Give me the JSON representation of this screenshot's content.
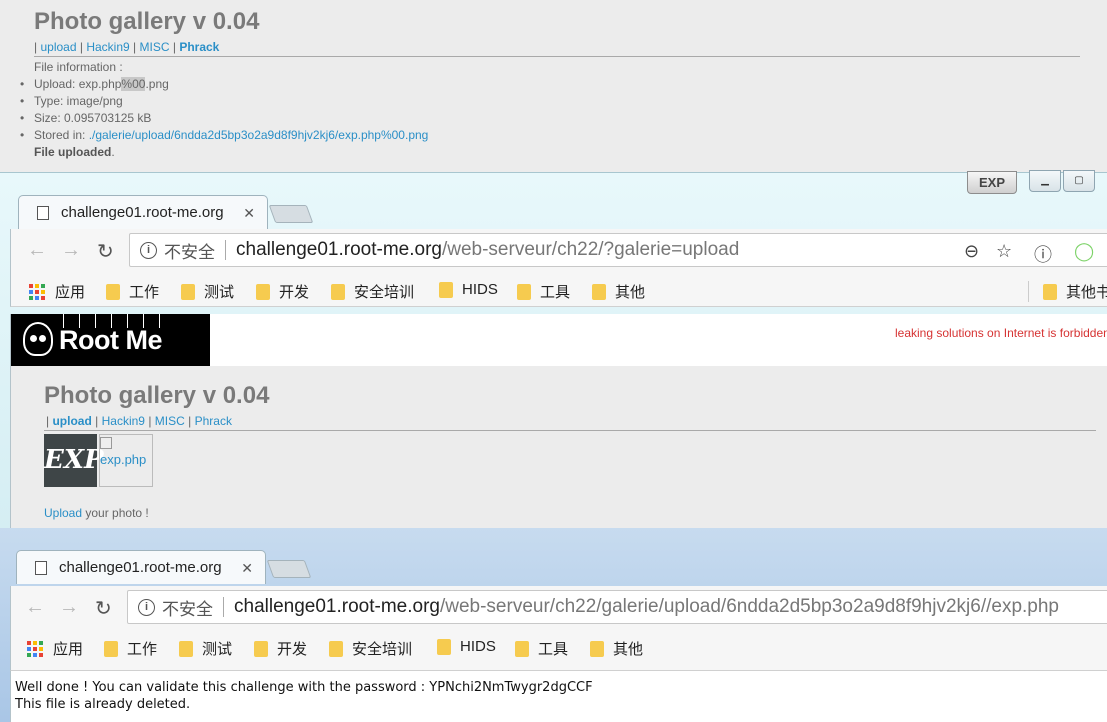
{
  "top_gallery": {
    "title": "Photo gallery v 0.04",
    "nav": {
      "sep": "|",
      "upload": "upload",
      "hackin9": "Hackin9",
      "misc": "MISC",
      "phrack": "Phrack"
    },
    "file_info_label": "File information :",
    "upload_label": "Upload:",
    "upload_name_pre": "exp.php",
    "upload_name_hl": "%00",
    "upload_name_post": ".png",
    "type": "Type: image/png",
    "size": "Size: 0.095703125 kB",
    "stored_label": "Stored in:",
    "stored_path": "./galerie/upload/6ndda2d5bp3o2a9d8f9hjv2kj6/exp.php%00.png",
    "file_uploaded_bold": "File uploaded",
    "file_uploaded_dot": "."
  },
  "window1": {
    "tab_title": "challenge01.root-me.org",
    "tab_close": "✕",
    "exp_button": "EXP",
    "address": {
      "insecure": "不安全",
      "host": "challenge01.root-me.org",
      "path": "/web-serveur/ch22/?galerie=upload"
    },
    "bookmarks": [
      "应用",
      "工作",
      "测试",
      "开发",
      "安全培训",
      "HIDS",
      "工具",
      "其他"
    ],
    "bookmarks_right": "其他书",
    "page": {
      "logo_text": "Root Me",
      "warning": "leaking solutions on Internet is forbidden",
      "gallery_title": "Photo gallery v 0.04",
      "nav": {
        "sep": "|",
        "upload": "upload",
        "hackin9": "Hackin9",
        "misc": "MISC",
        "phrack": "Phrack"
      },
      "exp_thumb": "EXP",
      "broken_img_alt": "exp.php",
      "upload_link": "Upload",
      "upload_tail": " your photo !"
    }
  },
  "window2": {
    "tab_title": "challenge01.root-me.org",
    "tab_close": "✕",
    "address": {
      "insecure": "不安全",
      "host": "challenge01.root-me.org",
      "path": "/web-serveur/ch22/galerie/upload/6ndda2d5bp3o2a9d8f9hjv2kj6//exp.php"
    },
    "bookmarks": [
      "应用",
      "工作",
      "测试",
      "开发",
      "安全培训",
      "HIDS",
      "工具",
      "其他"
    ],
    "page": {
      "line1": "Well done ! You can validate this challenge with the password : YPNchi2NmTwygr2dgCCF",
      "line2": "This file is already deleted."
    }
  },
  "icons": {
    "back": "←",
    "forward": "→",
    "reload": "↻",
    "info": "i",
    "zoom": "⊖",
    "star": "☆",
    "ext1": "ⓘ",
    "ext2": "◯"
  }
}
